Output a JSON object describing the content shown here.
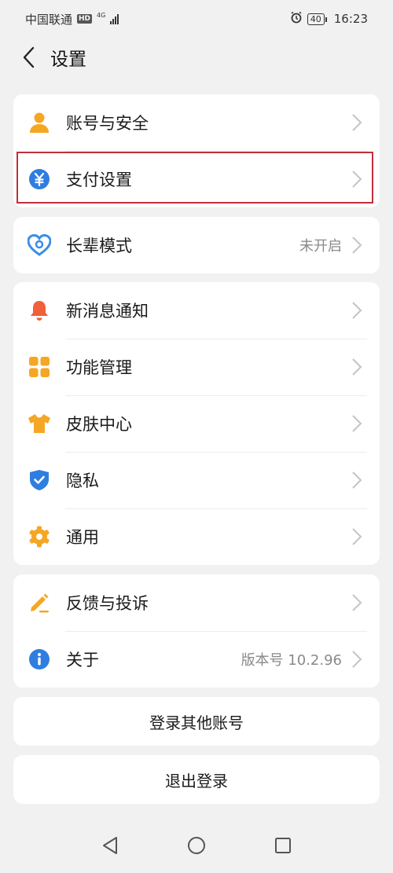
{
  "status_bar": {
    "carrier": "中国联通",
    "hd": "HD",
    "network": "4G",
    "battery": "40",
    "time": "16:23"
  },
  "header": {
    "title": "设置"
  },
  "groups": [
    {
      "items": [
        {
          "label": "账号与安全",
          "icon": "user-icon",
          "color": "#f5a623"
        },
        {
          "label": "支付设置",
          "icon": "yuan-icon",
          "color": "#2f7de1"
        }
      ]
    },
    {
      "items": [
        {
          "label": "长辈模式",
          "value": "未开启",
          "icon": "heart-icon",
          "color": "#3a8ee6"
        }
      ]
    },
    {
      "items": [
        {
          "label": "新消息通知",
          "icon": "bell-icon",
          "color": "#f0603a"
        },
        {
          "label": "功能管理",
          "icon": "grid-icon",
          "color": "#f5a623"
        },
        {
          "label": "皮肤中心",
          "icon": "shirt-icon",
          "color": "#f5a623"
        },
        {
          "label": "隐私",
          "icon": "shield-icon",
          "color": "#2f7de1"
        },
        {
          "label": "通用",
          "icon": "gear-icon",
          "color": "#f5a623"
        }
      ]
    },
    {
      "items": [
        {
          "label": "反馈与投诉",
          "icon": "pencil-icon",
          "color": "#f5a623"
        },
        {
          "label": "关于",
          "value": "版本号 10.2.96",
          "icon": "info-icon",
          "color": "#2f7de1"
        }
      ]
    }
  ],
  "buttons": {
    "switch_account": "登录其他账号",
    "logout": "退出登录"
  },
  "colors": {
    "highlight": "#c0303c",
    "background": "#f1f1f1"
  }
}
